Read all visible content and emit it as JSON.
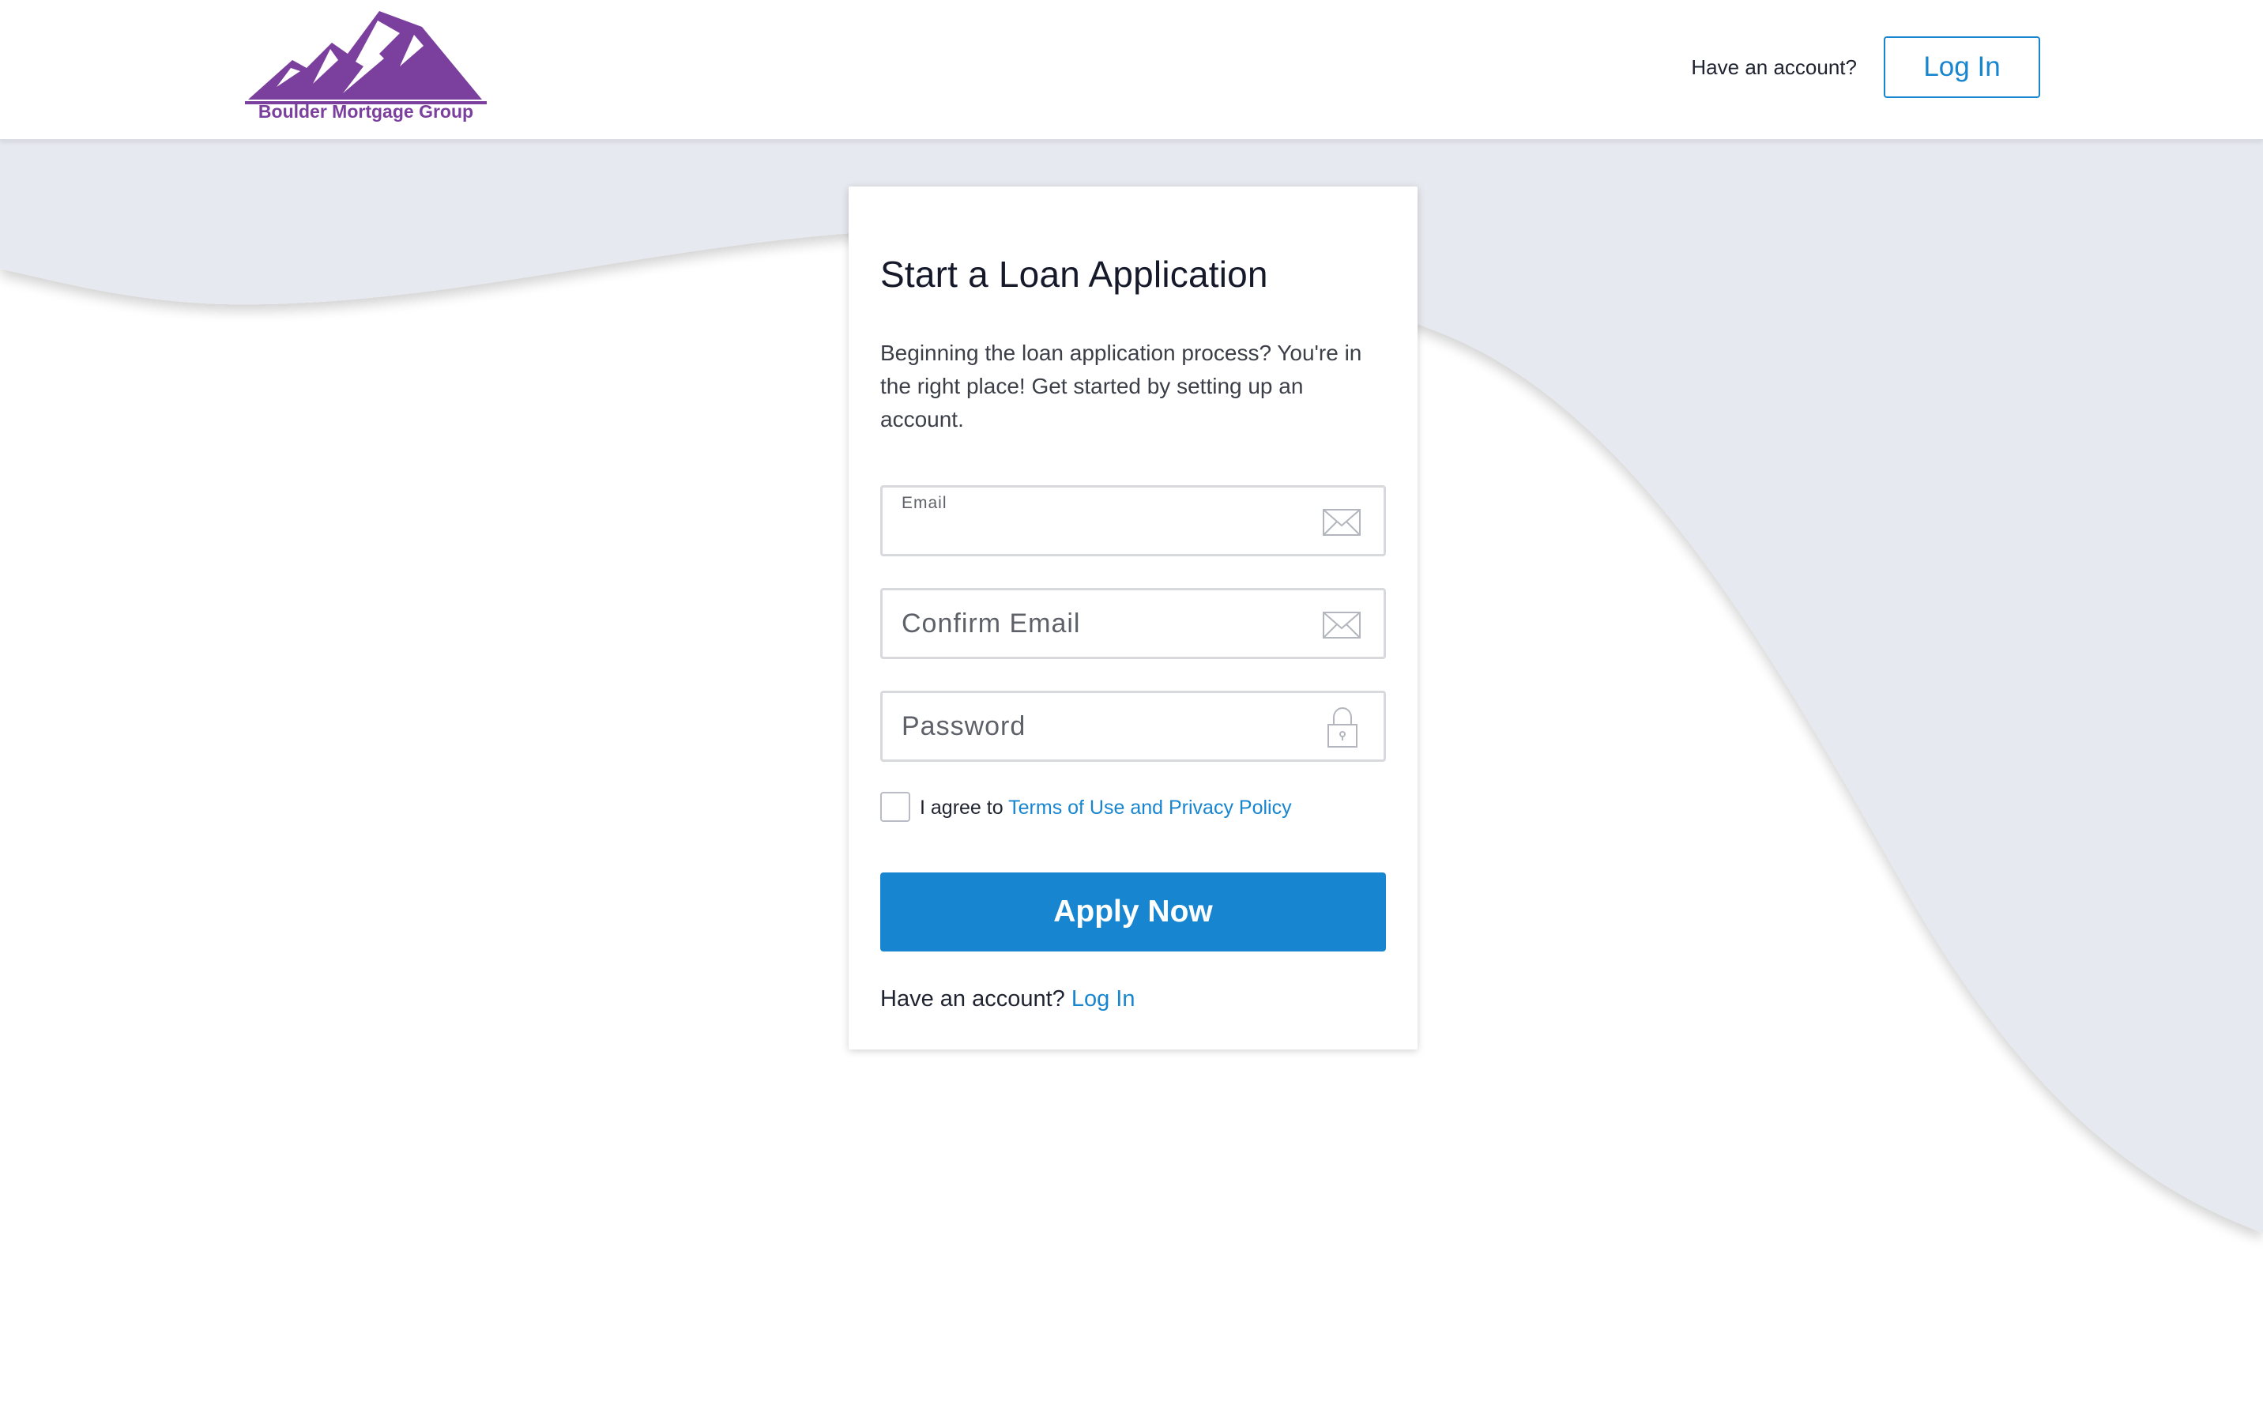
{
  "header": {
    "brand_name": "Boulder Mortgage Group",
    "account_prompt": "Have an account?",
    "login_label": "Log In"
  },
  "card": {
    "title": "Start a Loan Application",
    "description": "Beginning the loan application process? You're in the right place! Get started by setting up an account.",
    "fields": {
      "email": {
        "label": "Email",
        "value": ""
      },
      "confirm_email": {
        "placeholder": "Confirm Email",
        "value": ""
      },
      "password": {
        "placeholder": "Password",
        "value": ""
      }
    },
    "agree": {
      "prefix": "I agree to",
      "link": "Terms of Use and Privacy Policy",
      "checked": false
    },
    "apply_label": "Apply Now",
    "footer": {
      "prompt": "Have an account?",
      "login_link": "Log In"
    }
  },
  "icons": {
    "brand_logo": "mountain-logo",
    "email": "envelope-icon",
    "confirm_email": "envelope-icon",
    "password": "lock-icon"
  },
  "colors": {
    "brand_purple": "#7b3f9e",
    "accent_blue": "#1785cf",
    "background_wave": "#e6e9ef",
    "input_border": "#d7d9dd"
  }
}
